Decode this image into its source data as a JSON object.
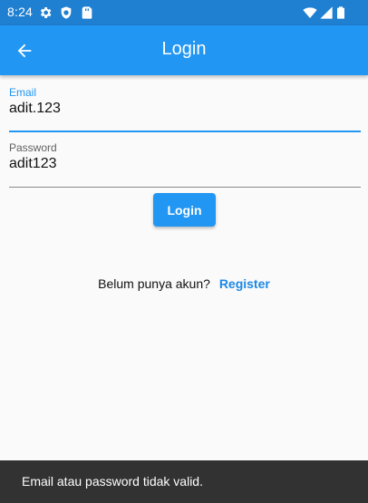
{
  "status_bar": {
    "time": "8:24",
    "left_icons": [
      "gear-icon",
      "shield-icon",
      "sim-card-icon"
    ],
    "right_icons": [
      "wifi-icon",
      "cell-signal-icon",
      "battery-icon"
    ],
    "background_color": "#1f7fd0"
  },
  "app_bar": {
    "title": "Login",
    "back_icon": "arrow-back-icon",
    "background_color": "#2196f3"
  },
  "form": {
    "email": {
      "label": "Email",
      "value": "adit.123",
      "focused": true
    },
    "password": {
      "label": "Password",
      "value": "adit123",
      "focused": false
    },
    "submit_label": "Login"
  },
  "register": {
    "prompt": "Belum punya akun?",
    "link_label": "Register"
  },
  "snackbar": {
    "message": "Email atau password tidak valid."
  },
  "colors": {
    "accent": "#2196f3",
    "link": "#1e88e5",
    "snackbar_bg": "#323232",
    "page_bg": "#fafafa"
  }
}
